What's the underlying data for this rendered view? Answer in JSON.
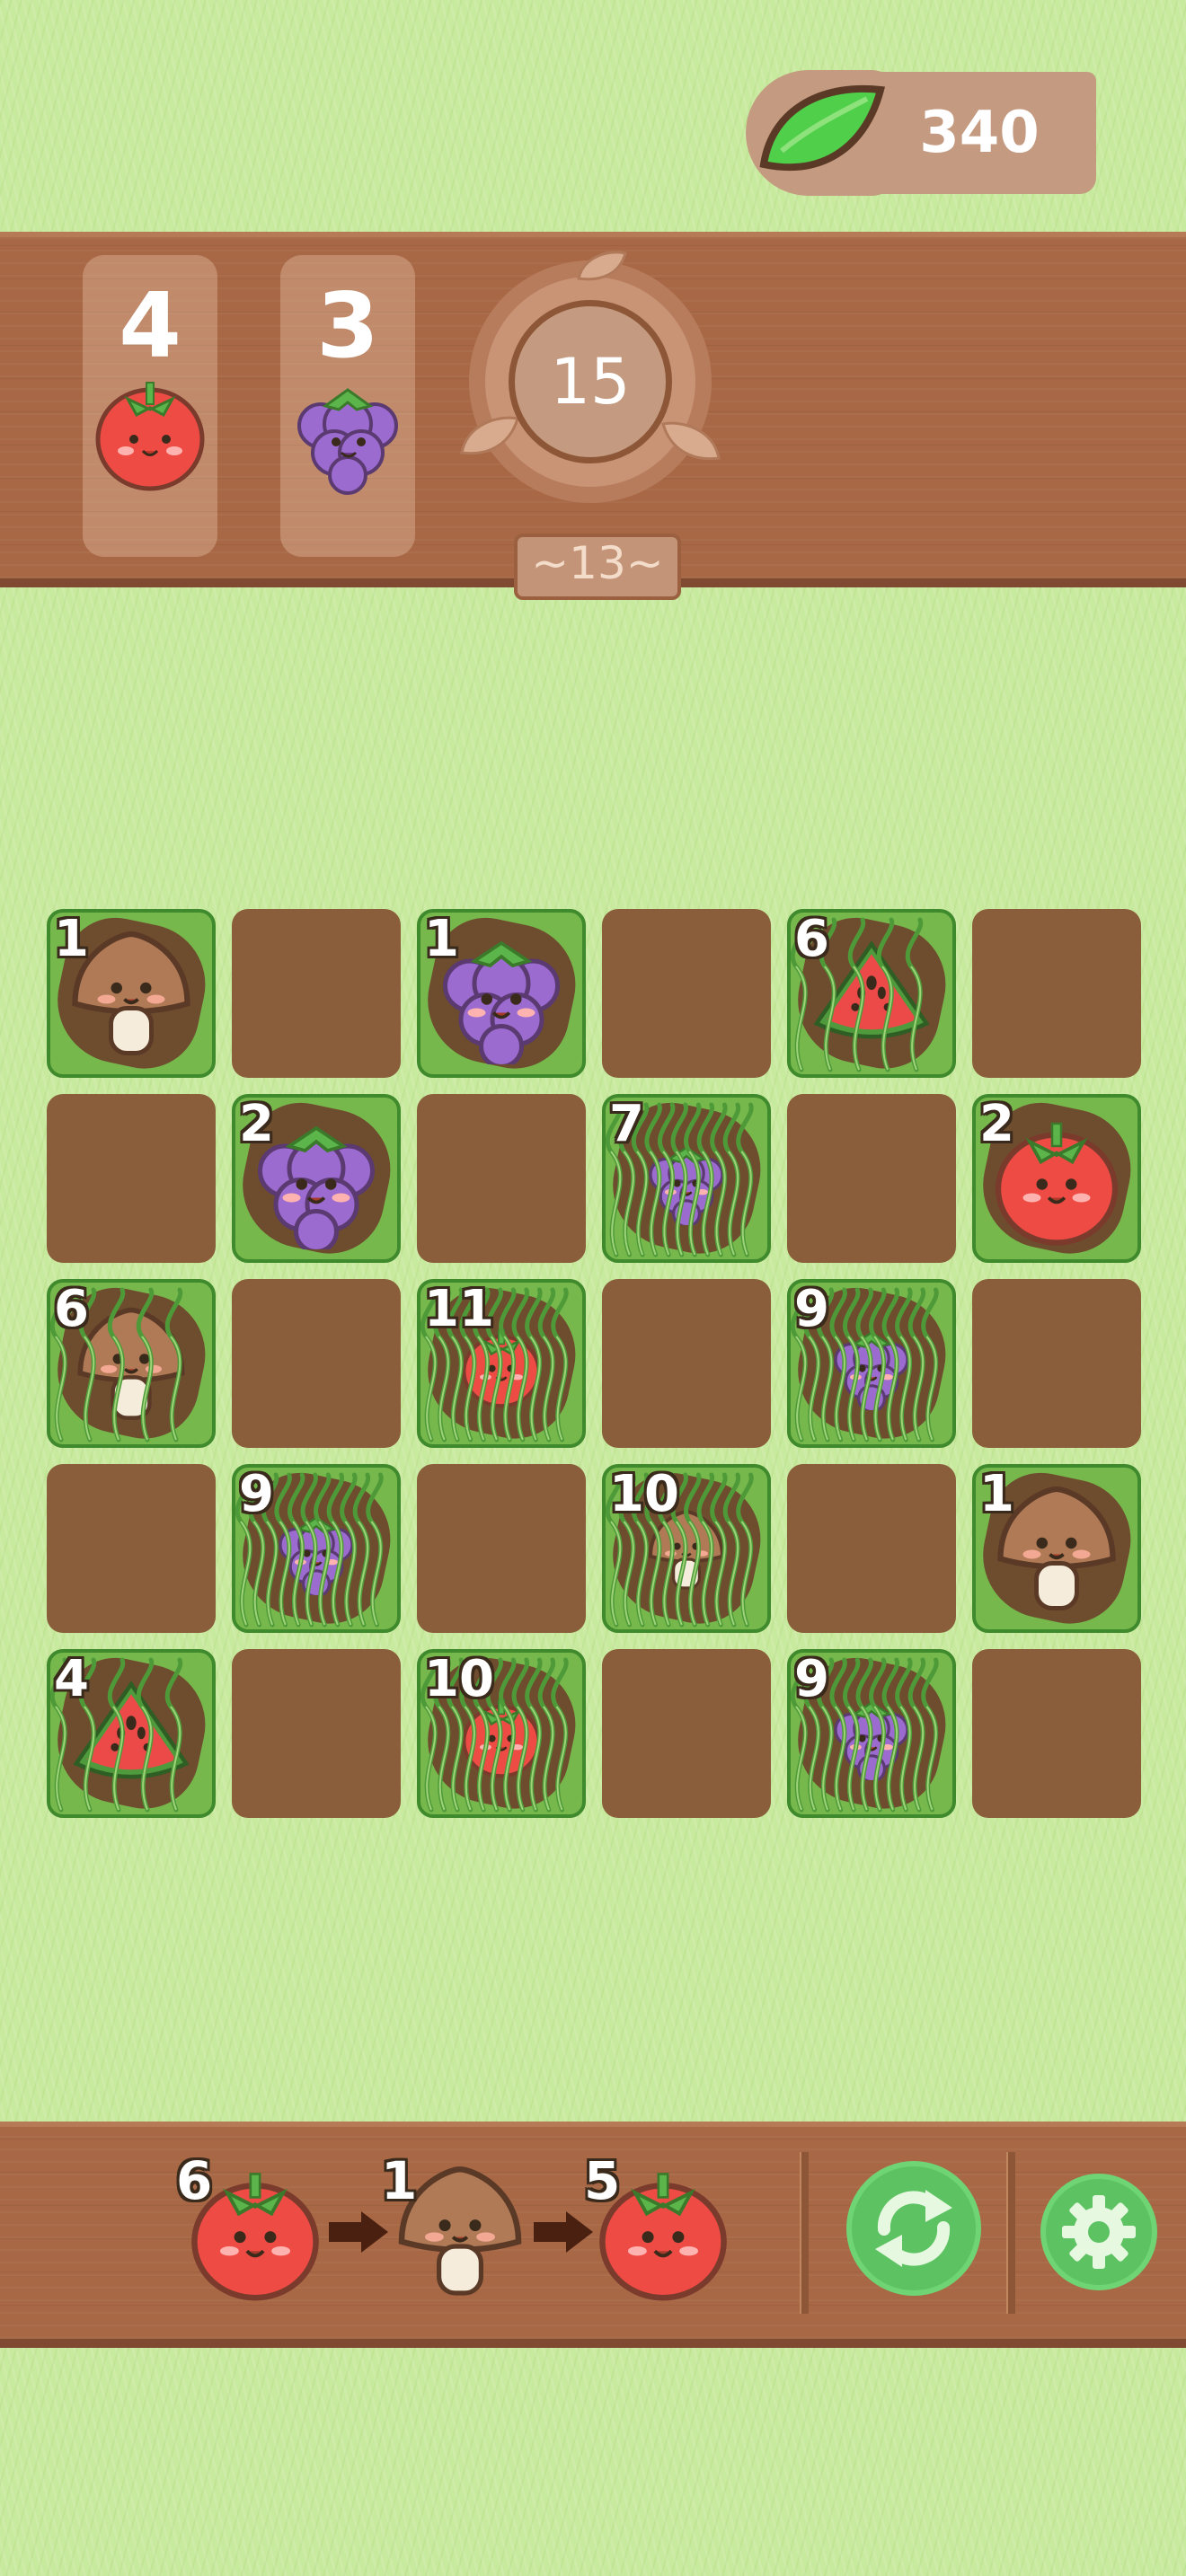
{
  "currency": {
    "icon": "leaf-icon",
    "value": "340"
  },
  "goals": [
    {
      "count": "4",
      "fruit": "tomato"
    },
    {
      "count": "3",
      "fruit": "grape"
    }
  ],
  "moves_left": "15",
  "level": "~13~",
  "board": {
    "rows": 5,
    "cols": 6,
    "cells": [
      [
        {
          "fruit": "mushroom",
          "num": "1",
          "vines": 0
        },
        null,
        {
          "fruit": "grape",
          "num": "1",
          "vines": 0
        },
        null,
        {
          "fruit": "watermelon",
          "num": "6",
          "vines": 1
        },
        null
      ],
      [
        null,
        {
          "fruit": "grape",
          "num": "2",
          "vines": 0
        },
        null,
        {
          "fruit": "grape",
          "num": "7",
          "vines": 2
        },
        null,
        {
          "fruit": "tomato",
          "num": "2",
          "vines": 0
        }
      ],
      [
        {
          "fruit": "mushroom",
          "num": "6",
          "vines": 1
        },
        null,
        {
          "fruit": "tomato",
          "num": "11",
          "vines": 2
        },
        null,
        {
          "fruit": "grape",
          "num": "9",
          "vines": 2
        },
        null
      ],
      [
        null,
        {
          "fruit": "grape",
          "num": "9",
          "vines": 2
        },
        null,
        {
          "fruit": "mushroom",
          "num": "10",
          "vines": 2
        },
        null,
        {
          "fruit": "mushroom",
          "num": "1",
          "vines": 0
        }
      ],
      [
        {
          "fruit": "watermelon",
          "num": "4",
          "vines": 1
        },
        null,
        {
          "fruit": "tomato",
          "num": "10",
          "vines": 2
        },
        null,
        {
          "fruit": "grape",
          "num": "9",
          "vines": 2
        },
        null
      ]
    ]
  },
  "queue": [
    {
      "fruit": "tomato",
      "num": "6"
    },
    {
      "fruit": "mushroom",
      "num": "1"
    },
    {
      "fruit": "tomato",
      "num": "5"
    }
  ],
  "buttons": {
    "shuffle_icon": "refresh-icon",
    "settings_icon": "gear-icon"
  },
  "colors": {
    "tomato": "#ee4b45",
    "grape": "#9b6bd0",
    "mushroom": "#b07a56",
    "watermelon": "#ec4a48",
    "leaf_green": "#5cc262",
    "wood": "#a86846"
  }
}
